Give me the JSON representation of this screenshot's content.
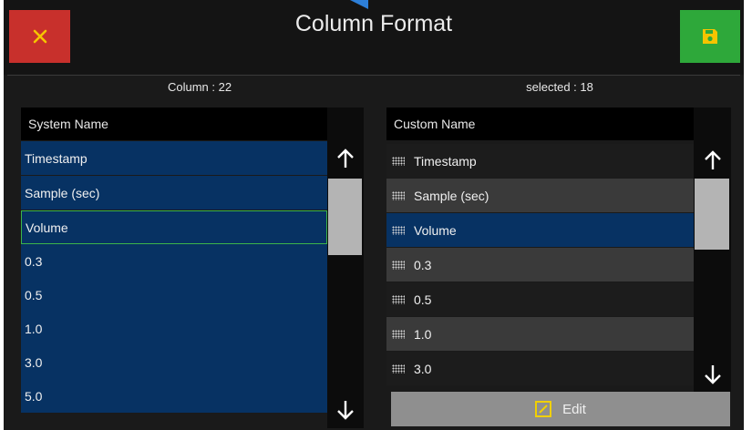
{
  "header": {
    "title": "Column Format",
    "close_icon": "close-icon",
    "save_icon": "save-icon",
    "colors": {
      "close": "#c8302c",
      "save": "#2ea83a",
      "accent": "#2d7fd8"
    }
  },
  "counts": {
    "column": "Column : 22",
    "selected": "selected : 18"
  },
  "system_list": {
    "header": "System Name",
    "items": [
      "Timestamp",
      "Sample (sec)",
      "Volume",
      "0.3",
      "0.5",
      "1.0",
      "3.0",
      "5.0"
    ],
    "focused_item": "Volume",
    "colors": {
      "row": "#073263",
      "focus_border": "#3cb44a"
    }
  },
  "custom_list": {
    "header": "Custom Name",
    "items": [
      "Timestamp",
      "Sample (sec)",
      "Volume",
      "0.3",
      "0.5",
      "1.0",
      "3.0"
    ],
    "selected_item": "Volume",
    "colors": {
      "row_dark": "#1c1c1c",
      "row_light": "#3a3a3a",
      "selected": "#073263"
    }
  },
  "scroll": {
    "up_icon": "arrow-up-icon",
    "down_icon": "arrow-down-icon"
  },
  "edit": {
    "label": "Edit",
    "icon": "edit-icon"
  }
}
